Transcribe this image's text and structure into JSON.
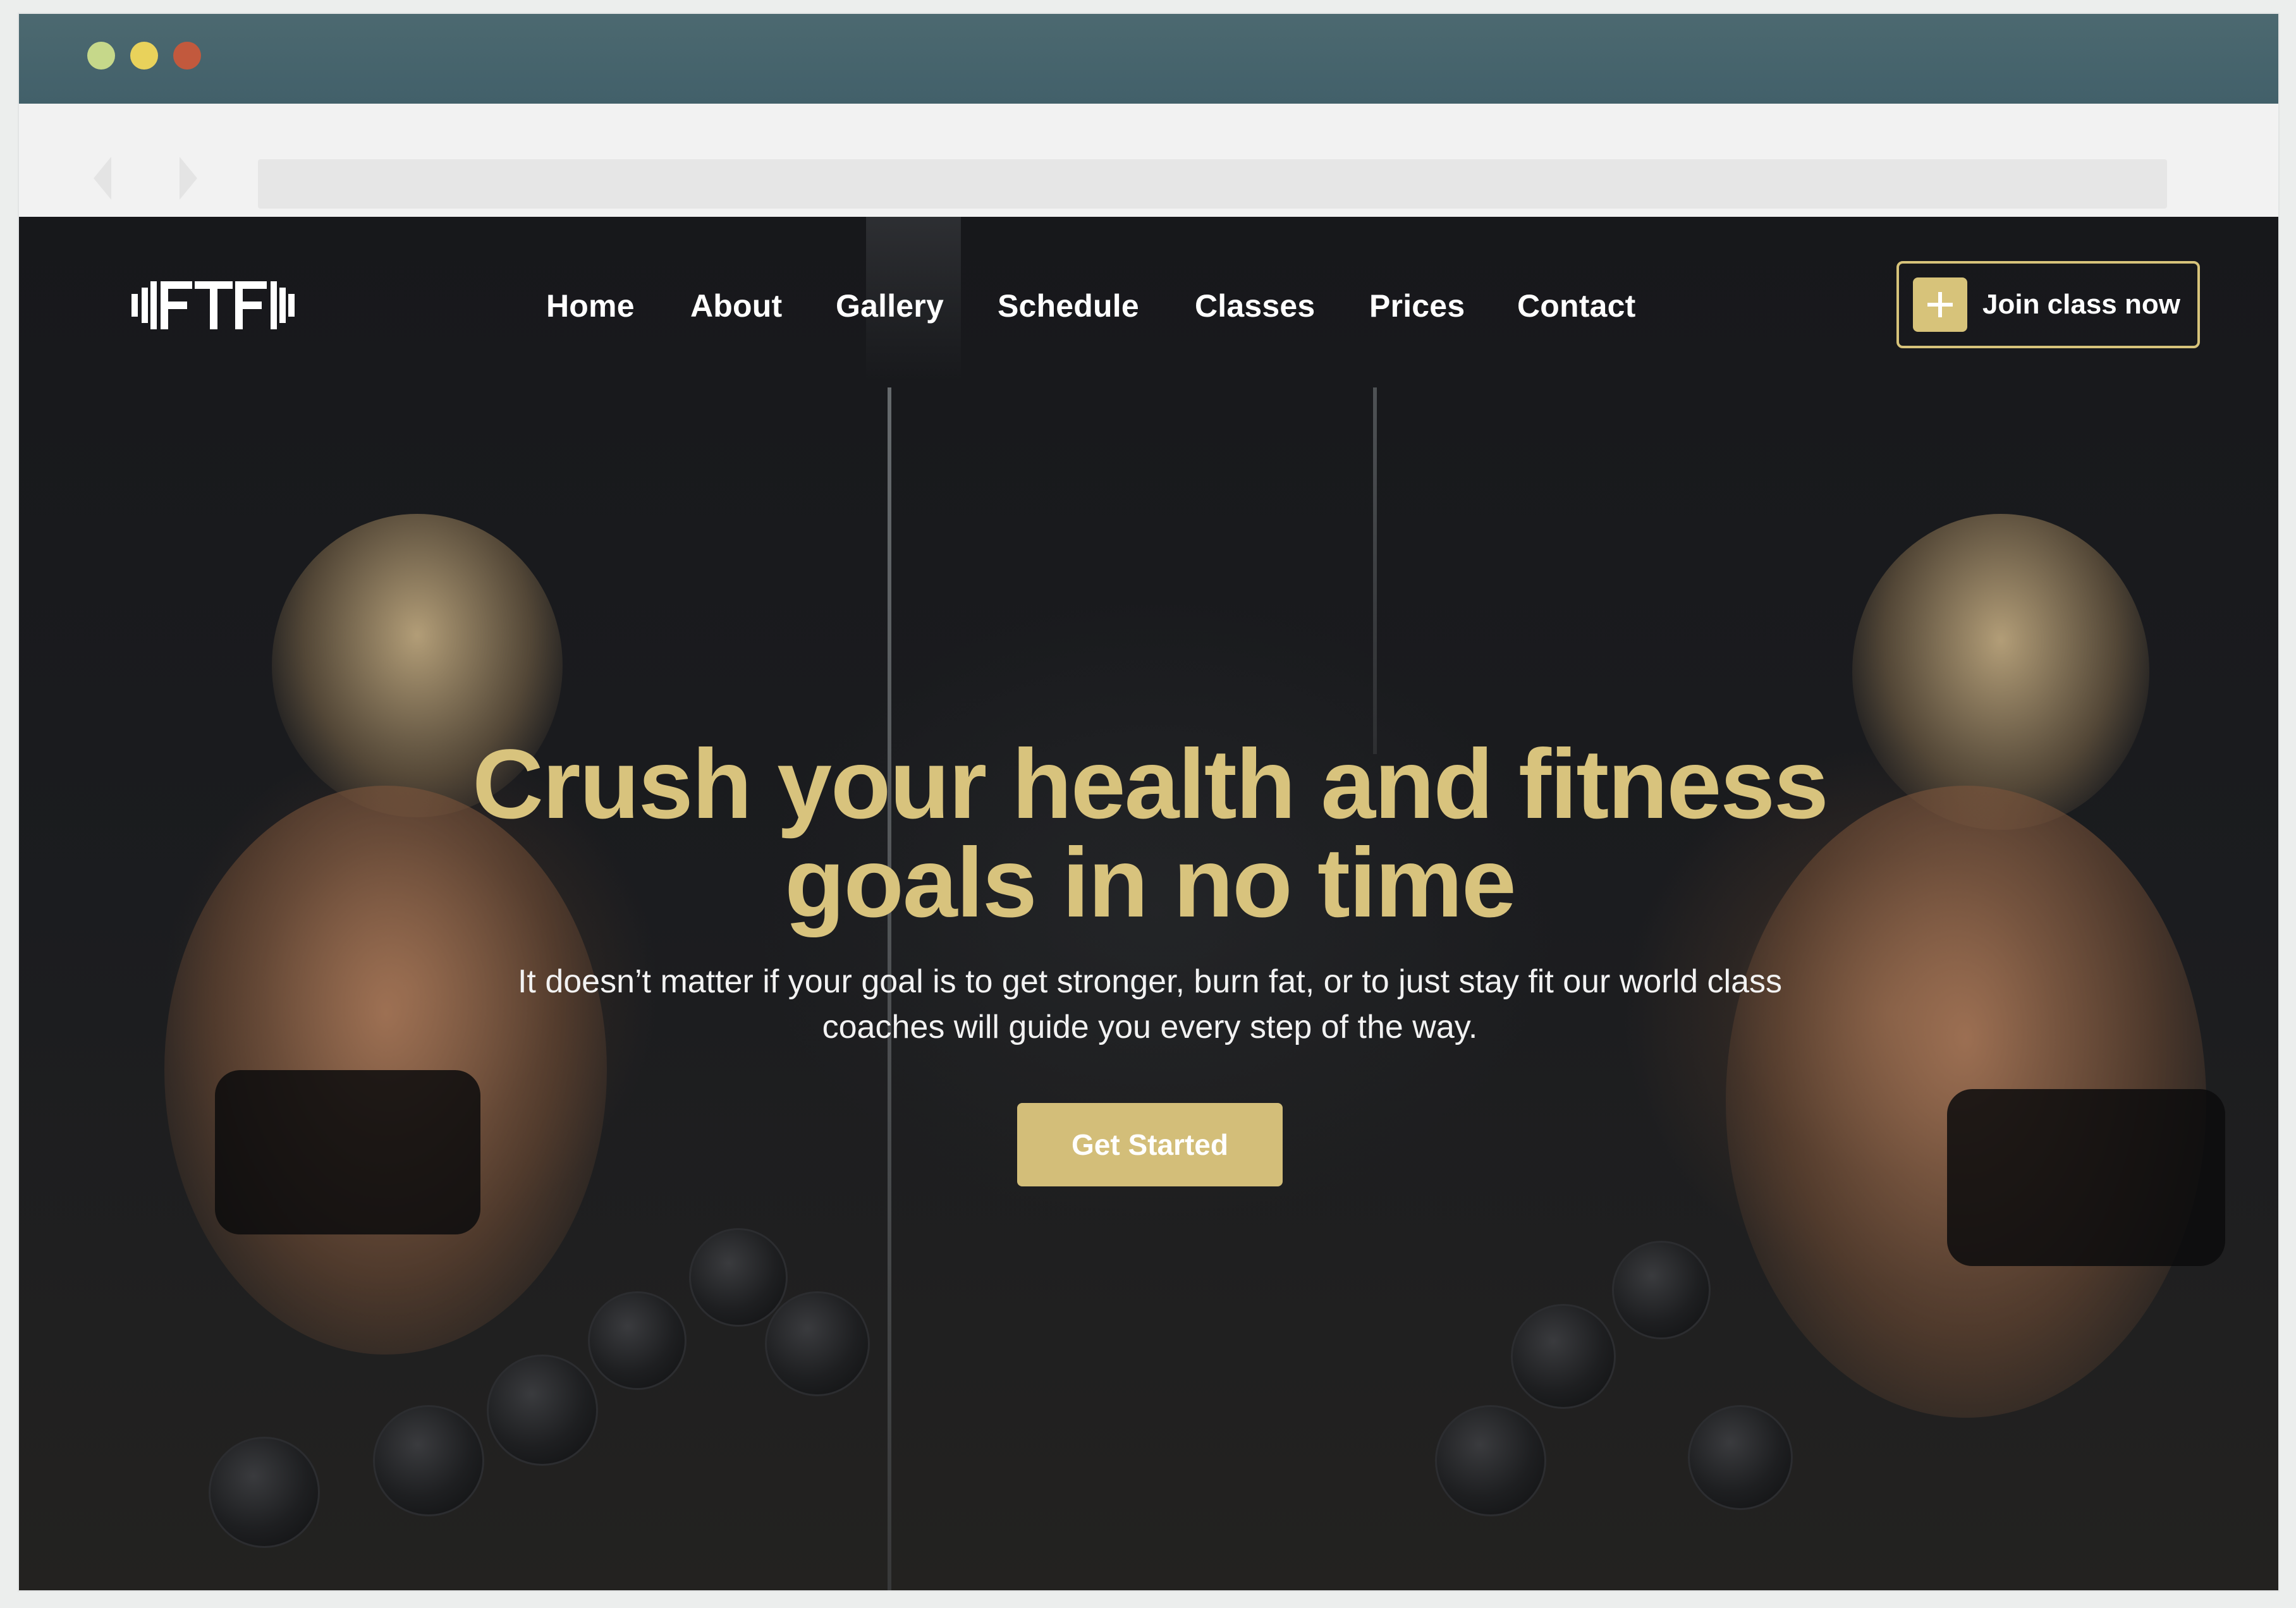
{
  "browser": {
    "traffic_lights": [
      "green-dot",
      "yellow-dot",
      "red-dot"
    ],
    "url": ""
  },
  "site": {
    "logo_alt": "brand logo",
    "nav": [
      {
        "label": "Home"
      },
      {
        "label": "About"
      },
      {
        "label": "Gallery"
      },
      {
        "label": "Schedule"
      },
      {
        "label": "Classes"
      },
      {
        "label": "Prices"
      },
      {
        "label": "Contact"
      }
    ],
    "cta": {
      "label": "Join class now",
      "icon": "plus-icon"
    }
  },
  "hero": {
    "title_line1": "Crush your health and fitness",
    "title_line2": "goals in no time",
    "subtitle": "It doesn’t matter if your goal is to get stronger, burn fat, or to just stay fit our world class coaches will guide you every step of the way.",
    "button_label": "Get Started"
  },
  "colors": {
    "accent": "#d8c37d",
    "background": "#17181b",
    "titlebar": "#46646c"
  }
}
